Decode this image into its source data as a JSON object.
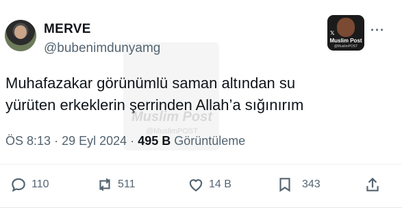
{
  "post": {
    "display_name": "MERVE",
    "handle": "@bubenimdunyamg",
    "text_line1": "Muhafazakar görünümlü saman altından su",
    "text_line2": "yürüten erkeklerin şerrinden Allah’a sığınırım",
    "time": "ÖS 8:13",
    "sep1": "·",
    "date": "29 Eyl 2024",
    "sep2": "·",
    "views": "495 B",
    "views_label": "Görüntüleme"
  },
  "badge": {
    "title": "Muslim Post",
    "subtitle": "@MuslimPOST"
  },
  "watermark": {
    "title": "Muslim Post",
    "subtitle": "@MuslimPOST"
  },
  "actions": {
    "replies": "110",
    "reposts": "511",
    "likes": "14 B",
    "bookmarks": "343"
  },
  "more_label": "···",
  "icons": [
    "reply-icon",
    "repost-icon",
    "like-icon",
    "bookmark-icon",
    "share-icon",
    "more-icon"
  ]
}
